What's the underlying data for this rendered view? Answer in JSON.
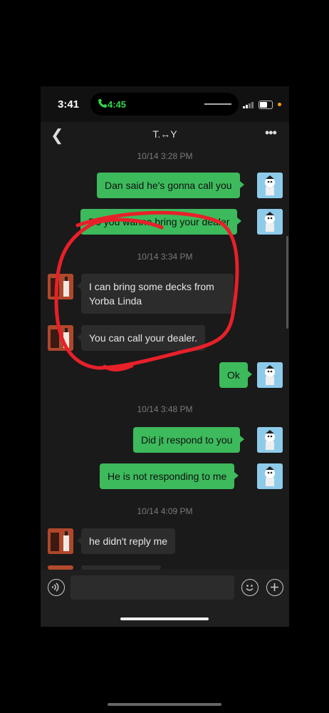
{
  "status_bar": {
    "time": "3:41",
    "call_time": "4:45",
    "accent": "#32d74b"
  },
  "header": {
    "title": "T.↔Y",
    "back_icon": "chevron-left-icon",
    "more_icon": "more-icon"
  },
  "messages": [
    {
      "type": "timestamp",
      "text": "10/14 3:28 PM"
    },
    {
      "type": "outgoing",
      "text": "Dan said he's gonna call you"
    },
    {
      "type": "outgoing",
      "text": "Do you wanna bring your dealer"
    },
    {
      "type": "timestamp",
      "text": "10/14 3:34 PM"
    },
    {
      "type": "incoming",
      "text": "I can bring some decks from Yorba Linda"
    },
    {
      "type": "incoming",
      "text": "You can call your dealer."
    },
    {
      "type": "outgoing",
      "text": "Ok"
    },
    {
      "type": "timestamp",
      "text": "10/14 3:48 PM"
    },
    {
      "type": "outgoing",
      "text": "Did jt respond to you"
    },
    {
      "type": "outgoing",
      "text": "He is not responding to me"
    },
    {
      "type": "timestamp",
      "text": "10/14 4:09 PM"
    },
    {
      "type": "incoming",
      "text": "he didn't reply me"
    }
  ],
  "colors": {
    "outgoing_bubble": "#3dba5c",
    "incoming_bubble": "#2c2c2c",
    "annotation_circle": "#e8202a"
  },
  "input_bar": {
    "voice_icon": "voice-icon",
    "emoji_icon": "emoji-icon",
    "plus_icon": "plus-icon"
  }
}
